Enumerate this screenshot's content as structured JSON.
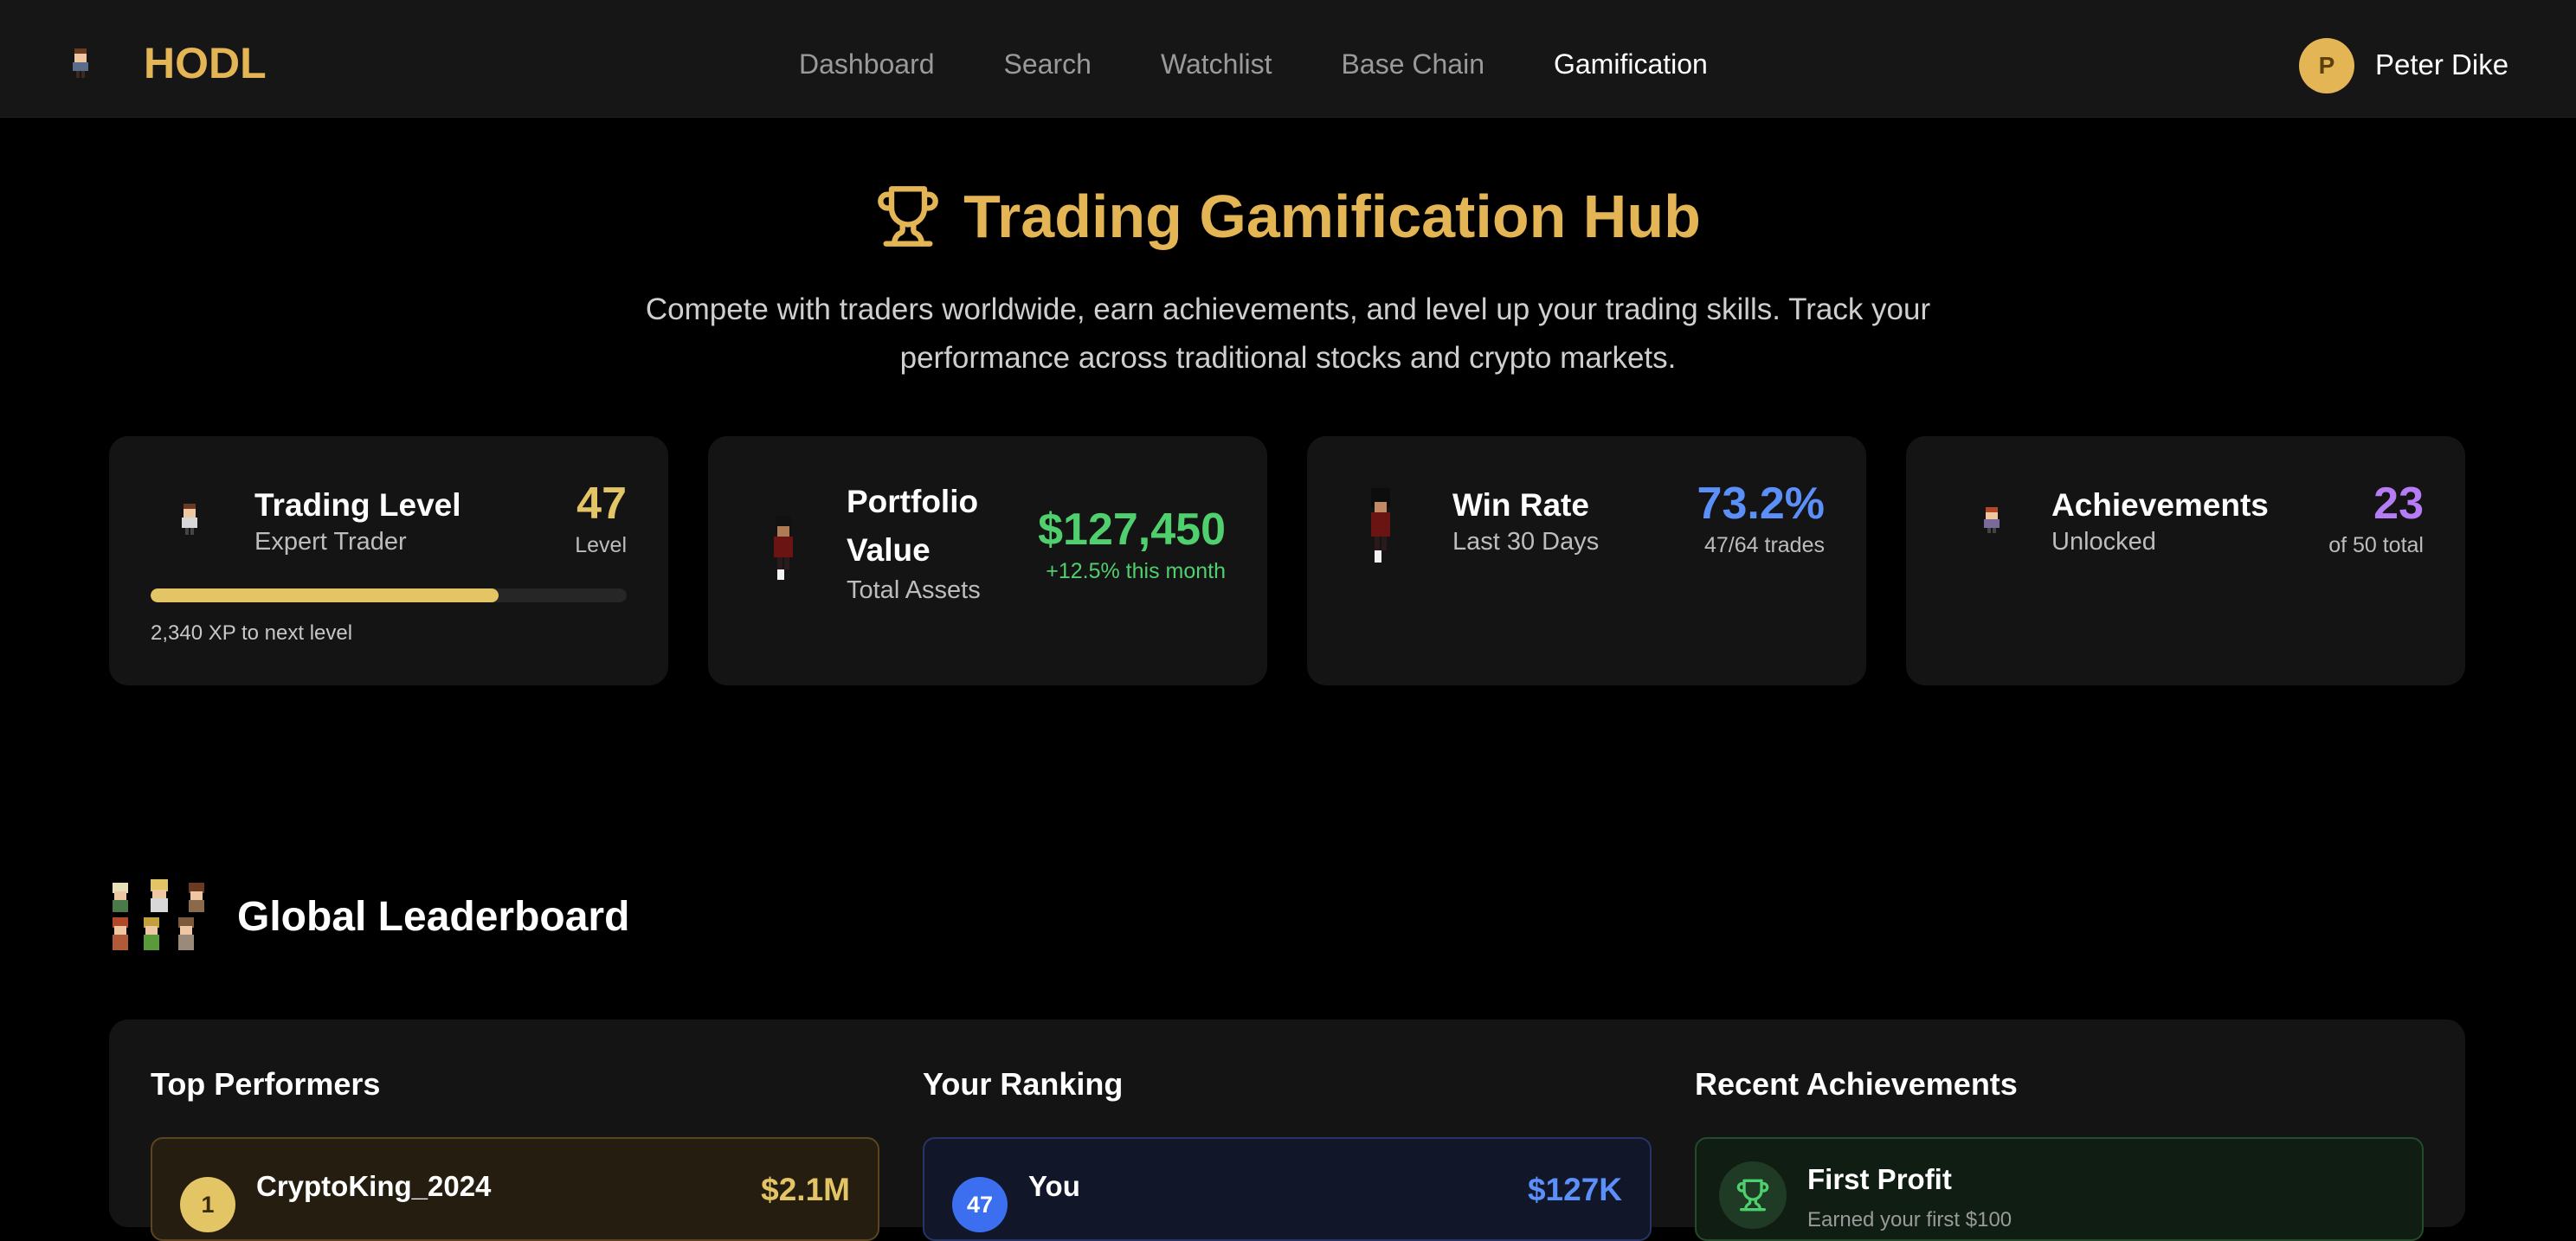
{
  "nav": {
    "brand": "HODL",
    "links": [
      "Dashboard",
      "Search",
      "Watchlist",
      "Base Chain",
      "Gamification"
    ],
    "active": "Gamification",
    "user": {
      "initial": "P",
      "name": "Peter Dike"
    }
  },
  "hero": {
    "title": "Trading Gamification Hub",
    "subtitle": "Compete with traders worldwide, earn achievements, and level up your trading skills. Track your performance across traditional stocks and crypto markets."
  },
  "stats": {
    "level": {
      "title": "Trading Level",
      "subtitle": "Expert Trader",
      "value": "47",
      "value_sub": "Level",
      "progress_fraction": 0.73,
      "xp_text": "2,340 XP to next level"
    },
    "portfolio": {
      "title": "Portfolio Value",
      "subtitle": "Total Assets",
      "value": "$127,450",
      "value_sub": "+12.5% this month"
    },
    "winrate": {
      "title": "Win Rate",
      "subtitle": "Last 30 Days",
      "value": "73.2%",
      "value_sub": "47/64 trades"
    },
    "achievements": {
      "title": "Achievements",
      "subtitle": "Unlocked",
      "value": "23",
      "value_sub": "of 50 total"
    }
  },
  "leaderboard": {
    "title": "Global Leaderboard",
    "top_performers": {
      "title": "Top Performers",
      "first": {
        "rank": "1",
        "name": "CryptoKing_2024",
        "value": "$2.1M"
      }
    },
    "your_ranking": {
      "title": "Your Ranking",
      "rank": "47",
      "name": "You",
      "value": "$127K"
    },
    "recent_achievements": {
      "title": "Recent Achievements",
      "first": {
        "name": "First Profit",
        "desc": "Earned your first $100"
      }
    }
  },
  "colors": {
    "gold": "#e3b554",
    "green": "#4fcf6e",
    "blue": "#5b8ff9",
    "purple": "#b57cf5",
    "background": "#000000",
    "card": "#141414"
  }
}
